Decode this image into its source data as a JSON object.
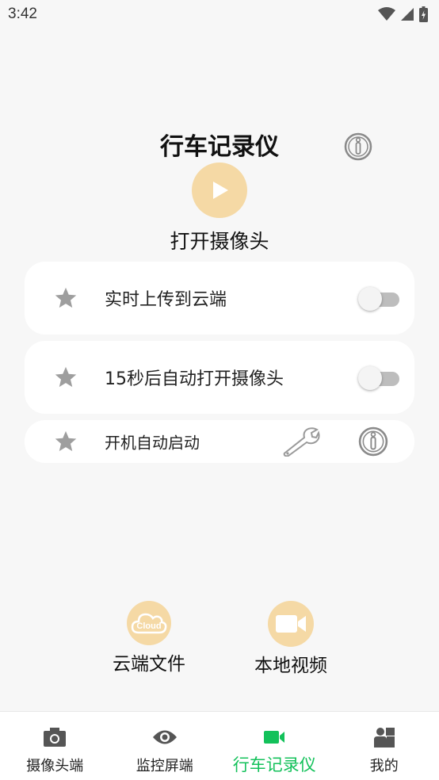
{
  "status_bar": {
    "time": "3:42"
  },
  "header": {
    "title": "行车记录仪"
  },
  "camera": {
    "open_label": "打开摄像头"
  },
  "settings": [
    {
      "label": "实时上传到云端",
      "enabled": false
    },
    {
      "label": "15秒后自动打开摄像头",
      "enabled": false
    },
    {
      "label": "开机自动启动"
    }
  ],
  "actions": {
    "cloud": {
      "label": "云端文件",
      "icon_text": "Cloud"
    },
    "local": {
      "label": "本地视频"
    }
  },
  "tabs": [
    {
      "label": "摄像头端",
      "icon": "camera-icon"
    },
    {
      "label": "监控屏端",
      "icon": "eye-icon"
    },
    {
      "label": "行车记录仪",
      "icon": "video-camera-icon",
      "active": true
    },
    {
      "label": "我的",
      "icon": "user-icon"
    }
  ],
  "colors": {
    "accent": "#13c15a",
    "action_circle": "#f5d9a5",
    "star": "#9e9e9e",
    "toggle_track": "#bdbdbd"
  }
}
